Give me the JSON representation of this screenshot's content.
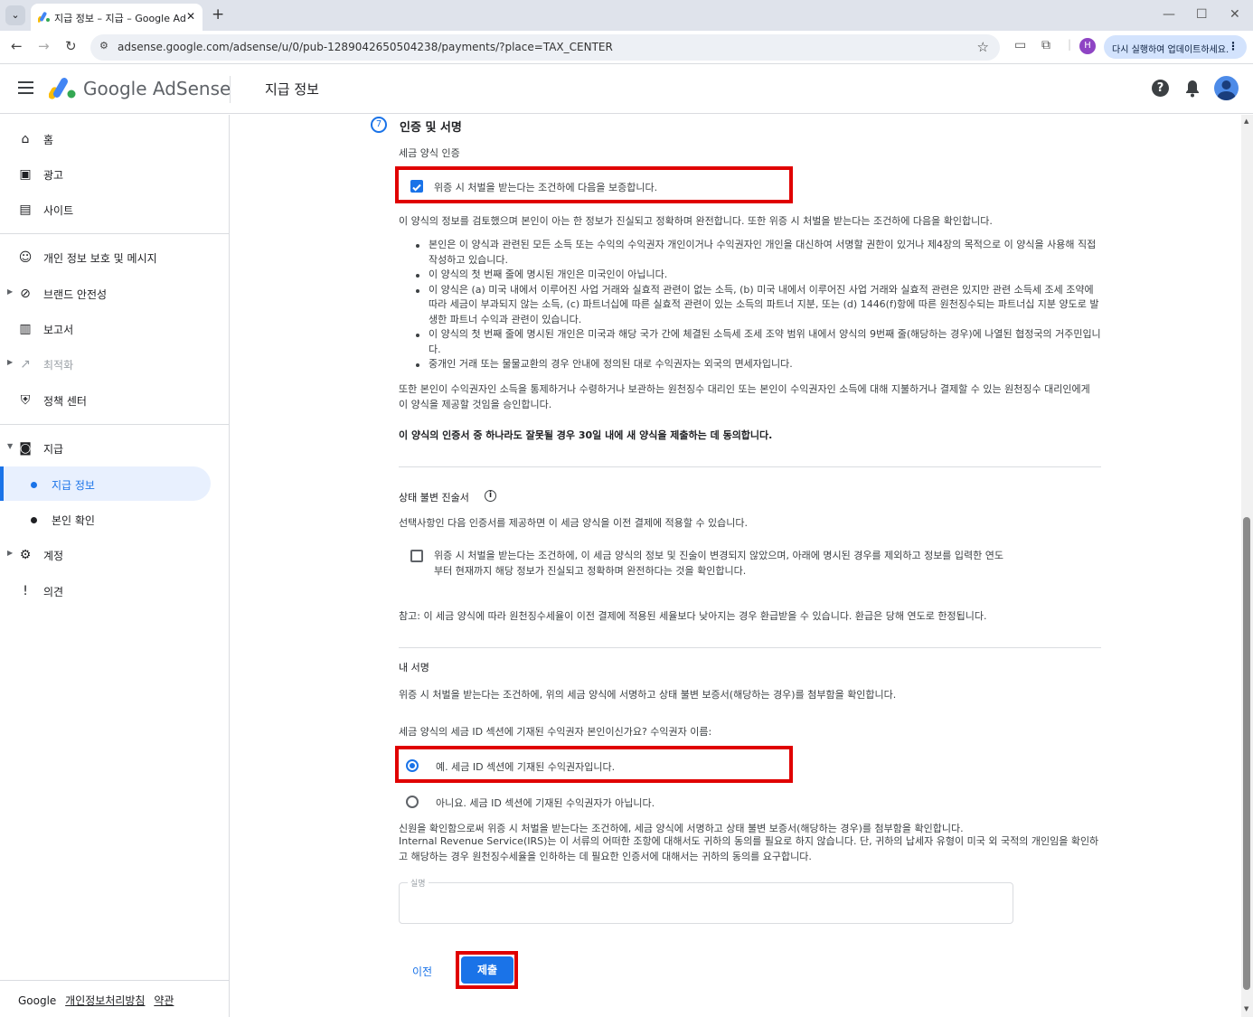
{
  "browser": {
    "tab_title": "지급 정보 – 지급 – Google Ad",
    "url": "adsense.google.com/adsense/u/0/pub-1289042650504238/payments/?place=TAX_CENTER",
    "profile_initial": "H",
    "update_label": "다시 실행하여 업데이트하세요."
  },
  "header": {
    "brand": "Google AdSense",
    "page_title": "지급 정보"
  },
  "sidebar": {
    "items": [
      {
        "label": "홈",
        "icon": "home-icon"
      },
      {
        "label": "광고",
        "icon": "ads-icon"
      },
      {
        "label": "사이트",
        "icon": "sites-icon"
      },
      {
        "label": "개인 정보 보호 및 메시지",
        "icon": "privacy-icon"
      },
      {
        "label": "브랜드 안전성",
        "icon": "block-icon"
      },
      {
        "label": "보고서",
        "icon": "reports-icon"
      },
      {
        "label": "최적화",
        "icon": "trending-icon"
      },
      {
        "label": "정책 센터",
        "icon": "policy-shield-icon"
      },
      {
        "label": "지급",
        "icon": "payments-icon"
      },
      {
        "label": "지급 정보"
      },
      {
        "label": "본인 확인"
      },
      {
        "label": "계정",
        "icon": "gear-icon"
      },
      {
        "label": "의견",
        "icon": "feedback-icon"
      }
    ],
    "footer": {
      "google": "Google",
      "privacy": "개인정보처리방침",
      "terms": "약관"
    }
  },
  "main": {
    "step_number": "7",
    "section_title": "인증 및 서명",
    "cert_heading": "세금 양식 인증",
    "cert_checkbox_label": "위증 시 처벌을 받는다는 조건하에 다음을 보증합니다.",
    "cert_intro": "이 양식의 정보를 검토했으며 본인이 아는 한 정보가 진실되고 정확하며 완전합니다. 또한 위증 시 처벌을 받는다는 조건하에 다음을 확인합니다.",
    "bullets": [
      "본인은 이 양식과 관련된 모든 소득 또는 수익의 수익권자 개인이거나 수익권자인 개인을 대신하여 서명할 권한이 있거나 제4장의 목적으로 이 양식을 사용해 직접 작성하고 있습니다.",
      "이 양식의 첫 번째 줄에 명시된 개인은 미국인이 아닙니다.",
      "이 양식은 (a) 미국 내에서 이루어진 사업 거래와 실효적 관련이 없는 소득, (b) 미국 내에서 이루어진 사업 거래와 실효적 관련은 있지만 관련 소득세 조세 조약에 따라 세금이 부과되지 않는 소득, (c) 파트너십에 따른 실효적 관련이 있는 소득의 파트너 지분, 또는 (d) 1446(f)항에 따른 원천징수되는 파트너십 지분 양도로 발생한 파트너 수익과 관련이 있습니다.",
      "이 양식의 첫 번째 줄에 명시된 개인은 미국과 해당 국가 간에 체결된 소득세 조세 조약 범위 내에서 양식의 9번째 줄(해당하는 경우)에 나열된 협정국의 거주민입니다.",
      "중개인 거래 또는 물물교환의 경우 안내에 정의된 대로 수익권자는 외국의 면세자입니다."
    ],
    "authorize_text": "또한 본인이 수익권자인 소득을 통제하거나 수령하거나 보관하는 원천징수 대리인 또는 본인이 수익권자인 소득에 대해 지불하거나 결제할 수 있는 원천징수 대리인에게 이 양식을 제공할 것임을 승인합니다.",
    "agree_text": "이 양식의 인증서 중 하나라도 잘못될 경우 30일 내에 새 양식을 제출하는 데 동의합니다.",
    "status_heading": "상태 불변 진술서",
    "status_intro": "선택사항인 다음 인증서를 제공하면 이 세금 양식을 이전 결제에 적용할 수 있습니다.",
    "status_checkbox_label": "위증 시 처벌을 받는다는 조건하에, 이 세금 양식의 정보 및 진술이 변경되지 않았으며, 아래에 명시된 경우를 제외하고 정보를 입력한 연도부터 현재까지 해당 정보가 진실되고 정확하며 완전하다는 것을 확인합니다.",
    "note_text": "참고: 이 세금 양식에 따라 원천징수세율이 이전 결제에 적용된 세율보다 낮아지는 경우 환급받을 수 있습니다. 환급은 당해 연도로 한정됩니다.",
    "sig_heading": "내 서명",
    "sig_intro": "위증 시 처벌을 받는다는 조건하에, 위의 세금 양식에 서명하고 상태 불변 보증서(해당하는 경우)를 첨부함을 확인합니다.",
    "sig_question": "세금 양식의 세금 ID 섹션에 기재된 수익권자 본인이신가요? 수익권자 이름:",
    "radio_yes": "예. 세금 ID 섹션에 기재된 수익권자입니다.",
    "radio_no": "아니요. 세금 ID 섹션에 기재된 수익권자가 아닙니다.",
    "consent_line1": "신원을 확인함으로써 위증 시 처벌을 받는다는 조건하에, 세금 양식에 서명하고 상태 불변 보증서(해당하는 경우)를 첨부함을 확인합니다.",
    "consent_line2": "Internal Revenue Service(IRS)는 이 서류의 어떠한 조항에 대해서도 귀하의 동의를 필요로 하지 않습니다. 단, 귀하의 납세자 유형이 미국 외 국적의 개인임을 확인하고 해당하는 경우 원천징수세율을 인하하는 데 필요한 인증서에 대해서는 귀하의 동의를 요구합니다.",
    "signature_label": "실명",
    "signature_value": "",
    "prev_button": "이전",
    "submit_button": "제출"
  }
}
